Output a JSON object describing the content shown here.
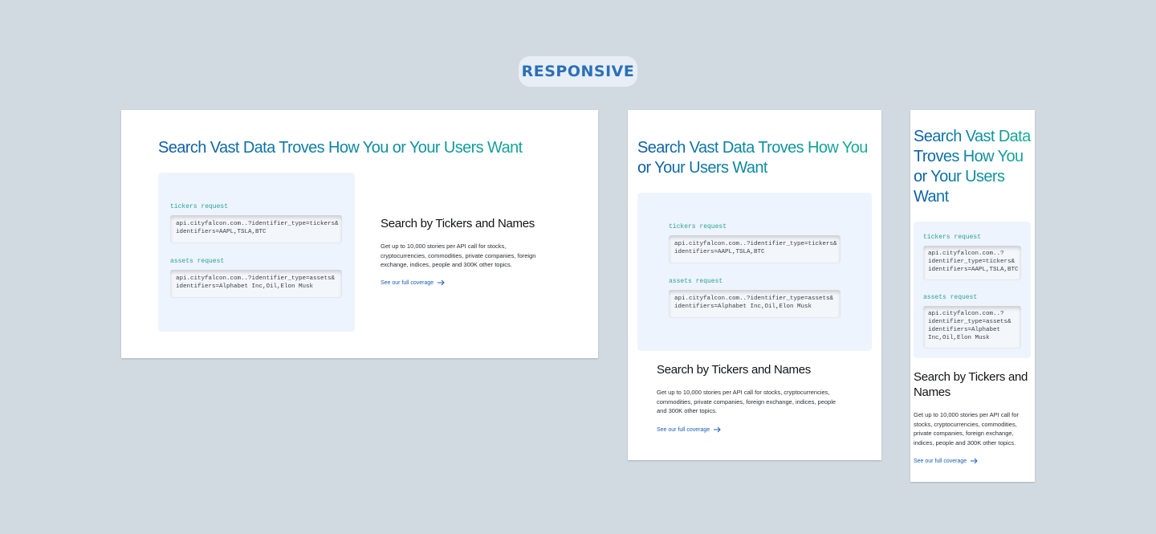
{
  "badge": "RESPONSIVE",
  "headline": "Search Vast Data Troves How You or Your Users Want",
  "tickers_label": "tickers request",
  "tickers_code": "api.cityfalcon.com..?identifier_type=tickers&\nidentifiers=AAPL,TSLA,BTC",
  "tickers_code_narrow": "api.cityfalcon.com..?\nidentifier_type=tickers&\nidentifiers=AAPL,TSLA,BTC",
  "assets_label": "assets request",
  "assets_code": "api.cityfalcon.com..?identifier_type=assets&\nidentifiers=Alphabet Inc,Oil,Elon Musk",
  "assets_code_narrow": "api.cityfalcon.com..?\nidentifier_type=assets&\nidentifiers=Alphabet\nInc,Oil,Elon Musk",
  "subheading": "Search by Tickers and Names",
  "body": "Get up to 10,000 stories per API call for stocks, cryptocurrencies, commodities, private companies, foreign exchange, indices, people and 300K other topics.",
  "link_label": "See our full coverage",
  "colors": {
    "background": "#d1d9e1",
    "accent_blue": "#0e5aa7",
    "accent_teal": "#14b08f",
    "panel": "#eef4fd",
    "link": "#1a5fb4"
  },
  "icons": {
    "link_arrow": "arrow-right-icon"
  }
}
